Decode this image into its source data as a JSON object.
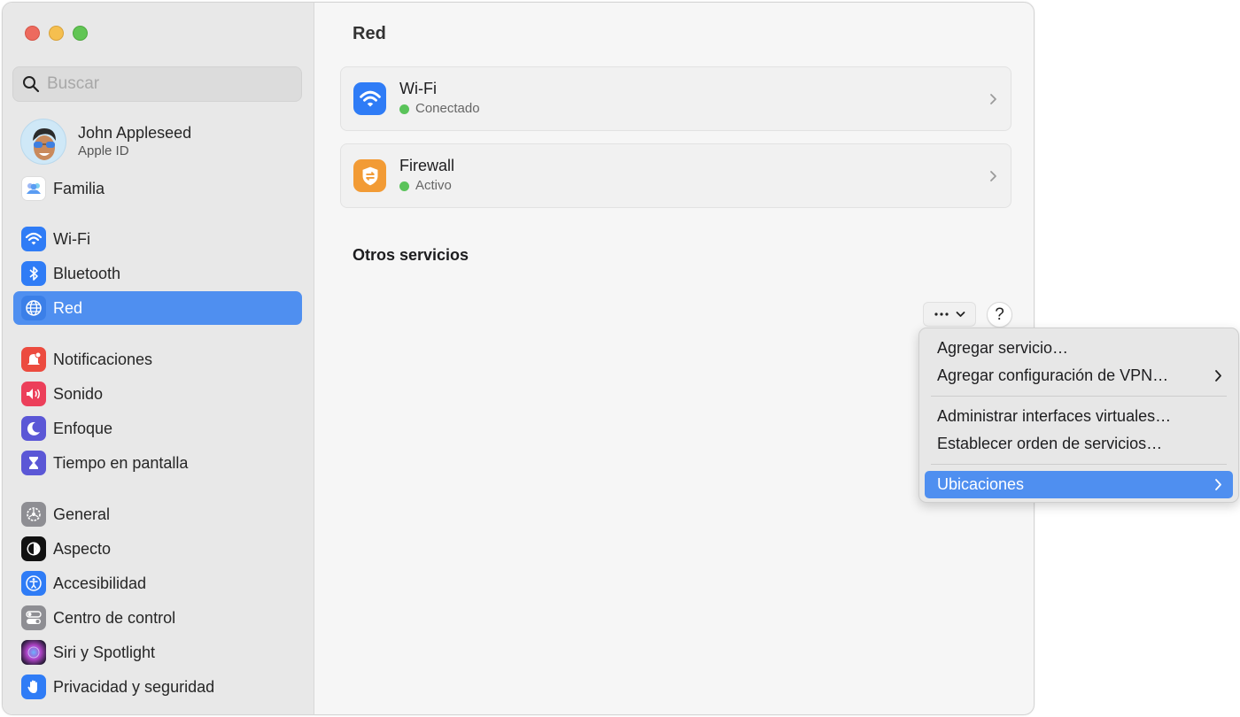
{
  "window": {
    "controls": [
      "close",
      "minimize",
      "maximize"
    ]
  },
  "sidebar": {
    "search": {
      "placeholder": "Buscar",
      "value": ""
    },
    "profile": {
      "name": "John Appleseed",
      "subtitle": "Apple ID"
    },
    "items": [
      {
        "id": "familia",
        "label": "Familia",
        "icon": "family-icon",
        "color": "#ffffff"
      },
      {
        "id": "wifi",
        "label": "Wi-Fi",
        "icon": "wifi-icon",
        "color": "#2f7cf6"
      },
      {
        "id": "bluetooth",
        "label": "Bluetooth",
        "icon": "bluetooth-icon",
        "color": "#2f7cf6"
      },
      {
        "id": "red",
        "label": "Red",
        "icon": "globe-icon",
        "color": "#2f7cf6",
        "selected": true
      },
      {
        "id": "notificaciones",
        "label": "Notificaciones",
        "icon": "bell-icon",
        "color": "#ec4b3f"
      },
      {
        "id": "sonido",
        "label": "Sonido",
        "icon": "speaker-icon",
        "color": "#ec3f5a"
      },
      {
        "id": "enfoque",
        "label": "Enfoque",
        "icon": "moon-icon",
        "color": "#5b57d6"
      },
      {
        "id": "tiempo",
        "label": "Tiempo en pantalla",
        "icon": "hourglass-icon",
        "color": "#5b57d6"
      },
      {
        "id": "general",
        "label": "General",
        "icon": "gear-icon",
        "color": "#8e8e93"
      },
      {
        "id": "aspecto",
        "label": "Aspecto",
        "icon": "appearance-icon",
        "color": "#111111"
      },
      {
        "id": "accesibilidad",
        "label": "Accesibilidad",
        "icon": "accessibility-icon",
        "color": "#2f7cf6"
      },
      {
        "id": "centro",
        "label": "Centro de control",
        "icon": "toggles-icon",
        "color": "#8e8e93"
      },
      {
        "id": "siri",
        "label": "Siri y Spotlight",
        "icon": "siri-icon",
        "color": "#3a2a4a"
      },
      {
        "id": "privacidad",
        "label": "Privacidad y seguridad",
        "icon": "hand-icon",
        "color": "#2f7cf6"
      }
    ]
  },
  "main": {
    "title": "Red",
    "cards": [
      {
        "title": "Wi-Fi",
        "status": "Conectado",
        "icon": "wifi-icon",
        "color": "#2f7cf6",
        "status_color": "#5ac35a"
      },
      {
        "title": "Firewall",
        "status": "Activo",
        "icon": "firewall-shield-icon",
        "color": "#f29b35",
        "status_color": "#5ac35a"
      }
    ],
    "other_services_title": "Otros servicios",
    "more_button_label": "···",
    "help_button_label": "?"
  },
  "menu": {
    "items": [
      {
        "label": "Agregar servicio…",
        "submenu": false
      },
      {
        "label": "Agregar configuración de VPN…",
        "submenu": true
      },
      {
        "separator": true
      },
      {
        "label": "Administrar interfaces virtuales…",
        "submenu": false
      },
      {
        "label": "Establecer orden de servicios…",
        "submenu": false
      },
      {
        "separator": true
      },
      {
        "label": "Ubicaciones",
        "submenu": true,
        "highlighted": true
      }
    ]
  },
  "colors": {
    "accent": "#4f8ff0",
    "status_green": "#5ac35a"
  }
}
